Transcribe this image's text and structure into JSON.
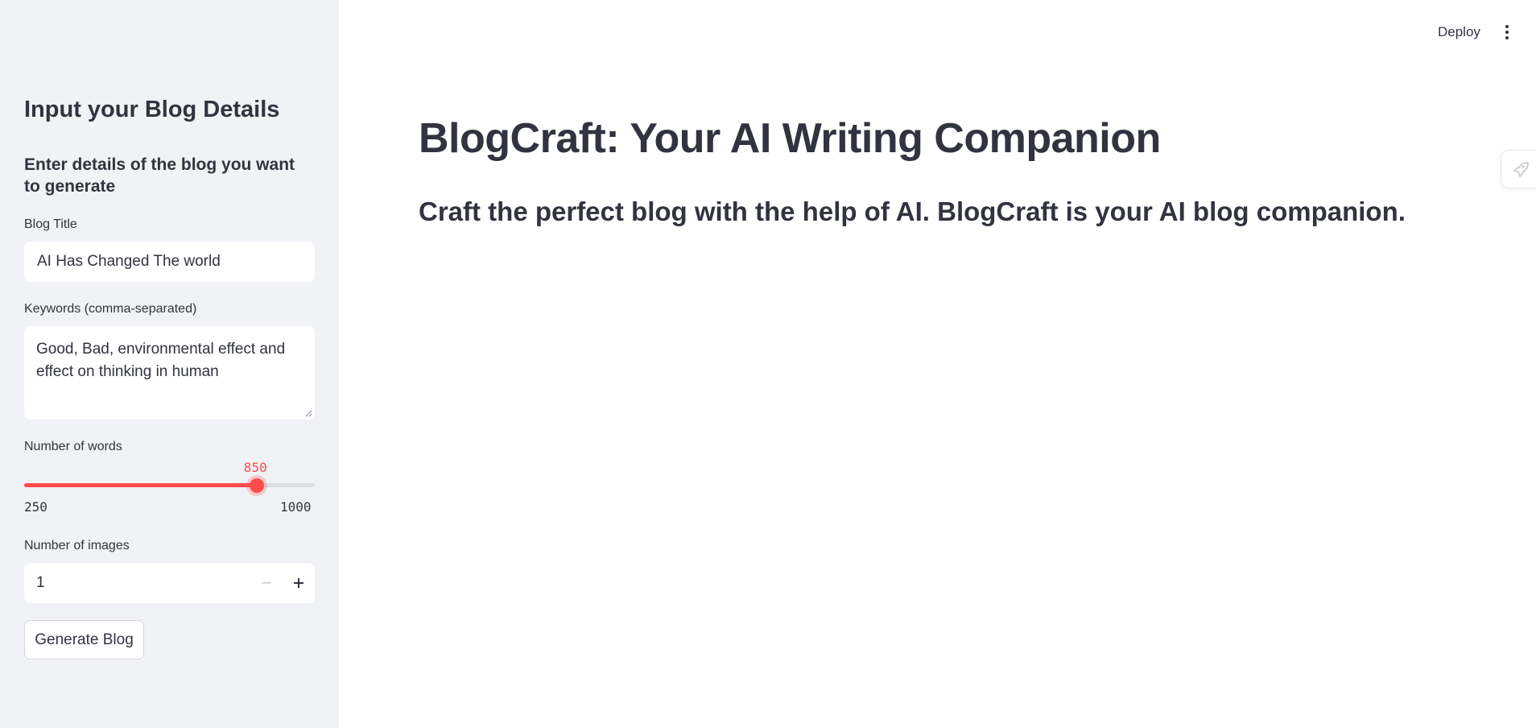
{
  "header": {
    "deploy_label": "Deploy",
    "menu_icon": "kebab-menu-icon"
  },
  "sidebar": {
    "header": "Input your Blog Details",
    "subheader": "Enter details of the blog you want to generate",
    "blog_title": {
      "label": "Blog Title",
      "value": "AI Has Changed The world"
    },
    "keywords": {
      "label": "Keywords (comma-separated)",
      "value": "Good, Bad, environmental effect and effect on thinking  in human"
    },
    "words_slider": {
      "label": "Number of words",
      "value": 850,
      "value_text": "850",
      "min": 250,
      "min_text": "250",
      "max": 1000,
      "max_text": "1000"
    },
    "images": {
      "label": "Number of images",
      "value": "1",
      "minus_icon": "minus-icon",
      "plus_icon": "plus-icon"
    },
    "generate_label": "Generate Blog"
  },
  "main": {
    "title": "BlogCraft: Your AI Writing Companion",
    "subtitle": "Craft the perfect blog with the help of AI. BlogCraft is your AI blog companion."
  },
  "floating_icon": "rocket-icon",
  "colors": {
    "accent": "#ff4b4b",
    "sidebar_bg": "#f0f2f6",
    "text": "#31333f"
  }
}
